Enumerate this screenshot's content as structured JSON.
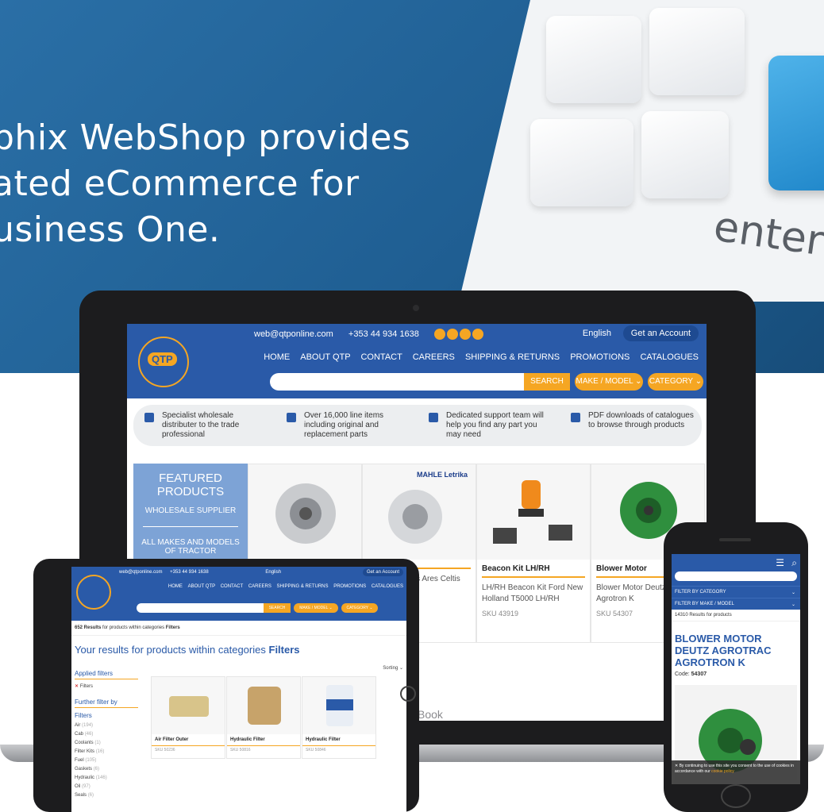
{
  "hero": {
    "line1": "phix WebShop provides",
    "line2": "ated eCommerce for",
    "line3": "usiness One.",
    "keyboard_key_text": "enter"
  },
  "laptop": {
    "brand_fragment": "Book",
    "site": {
      "email": "web@qtponline.com",
      "phone": "+353 44 934 1638",
      "language": "English",
      "account_button": "Get an Account",
      "logo_text": "QTP",
      "nav": [
        "HOME",
        "ABOUT QTP",
        "CONTACT",
        "CAREERS",
        "SHIPPING & RETURNS",
        "PROMOTIONS",
        "CATALOGUES"
      ],
      "search_button": "SEARCH",
      "make_model_button": "MAKE / MODEL ⌄",
      "category_button": "CATEGORY ⌄",
      "features": [
        "Specialist wholesale distributer to the trade professional",
        "Over 16,000 line items including original and replacement parts",
        "Dedicated support team will help you find any part you may need",
        "PDF downloads of catalogues to browse through products"
      ],
      "featured": {
        "title_1": "FEATURED",
        "title_2": "PRODUCTS",
        "sub_1": "WHOLESALE SUPPLIER",
        "sub_2": "ALL MAKES AND MODELS OF TRACTOR"
      },
      "brand_logo": "MAHLE Letrika",
      "products": [
        {
          "name": "",
          "desc": "",
          "sku": ""
        },
        {
          "name": "",
          "desc": "Models t Claas Ares Celtis",
          "sku": ""
        },
        {
          "name": "Beacon Kit LH/RH",
          "desc": "LH/RH Beacon Kit Ford New Holland T5000 LH/RH",
          "sku": "SKU 43919"
        },
        {
          "name": "Blower Motor",
          "desc": "Blower Motor Deutz Ag Agrotron K",
          "sku": "SKU 54307"
        }
      ]
    }
  },
  "tablet": {
    "email": "web@qtponline.com",
    "phone": "+353 44 934 1638",
    "language": "English",
    "account_button": "Get an Account",
    "nav": [
      "HOME",
      "ABOUT QTP",
      "CONTACT",
      "CAREERS",
      "SHIPPING & RETURNS",
      "PROMOTIONS",
      "CATALOGUES"
    ],
    "search_button": "SEARCH",
    "make_model_button": "MAKE / MODEL ⌄",
    "category_button": "CATEGORY ⌄",
    "results_count": "652 Results",
    "results_suffix": "for products within categories",
    "results_filter": "Filters",
    "heading_prefix": "Your results for products within categories",
    "heading_bold": "Filters",
    "sorting": "Sorting ⌄",
    "applied_filters": "Applied filters",
    "applied_item": "Filters",
    "further_filter": "Further filter by",
    "filters_title": "Filters",
    "filter_items": [
      {
        "name": "Air",
        "count": "(194)"
      },
      {
        "name": "Cab",
        "count": "(46)"
      },
      {
        "name": "Coolants",
        "count": "(1)"
      },
      {
        "name": "Filter Kits",
        "count": "(16)"
      },
      {
        "name": "Fuel",
        "count": "(105)"
      },
      {
        "name": "Gaskets",
        "count": "(6)"
      },
      {
        "name": "Hydraulic",
        "count": "(146)"
      },
      {
        "name": "Oil",
        "count": "(97)"
      },
      {
        "name": "Seals",
        "count": "(6)"
      }
    ],
    "products": [
      {
        "name": "Air Filter Outer",
        "sku": "SKU 50236"
      },
      {
        "name": "Hydraulic Filter",
        "sku": "SKU 50816"
      },
      {
        "name": "Hydraulic Filter",
        "sku": "SKU 50846"
      }
    ]
  },
  "phone": {
    "filter_category": "FILTER BY CATEGORY",
    "filter_make": "FILTER BY MAKE / MODEL",
    "results": "14310 Results for products",
    "title": "BLOWER MOTOR DEUTZ AGROTRAC AGROTRON K",
    "code_label": "Code:",
    "code_value": "54307",
    "cookie_text": "By continuing to use this site you consent to the use of cookies in accordance with our",
    "cookie_link": "cookie policy"
  },
  "colors": {
    "brand_blue": "#2a5aa8",
    "brand_orange": "#f5a623",
    "hero_blue": "#1f5e92"
  }
}
